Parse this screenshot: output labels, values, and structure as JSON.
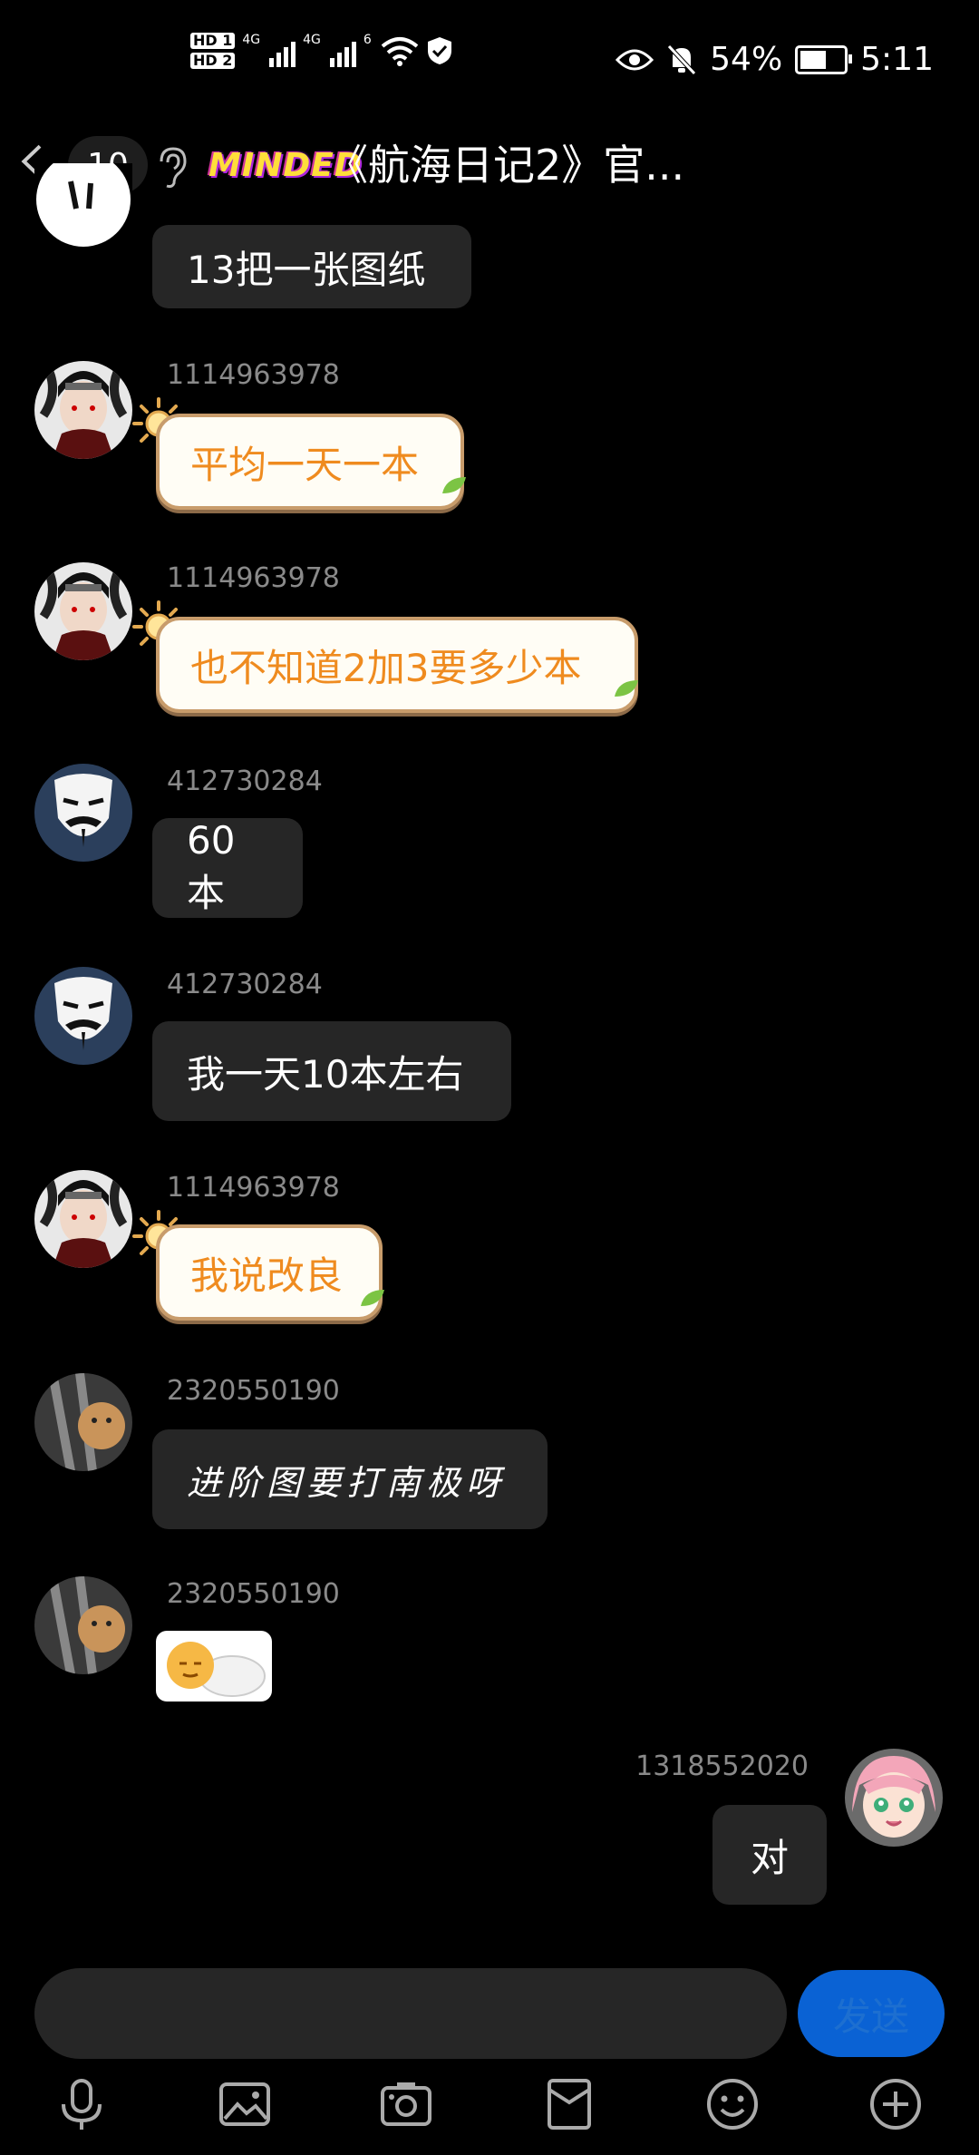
{
  "status_bar": {
    "hd1": "HD 1",
    "hd2": "HD 2",
    "net1": "4G",
    "net2": "4G",
    "wifi": "6",
    "battery": "54%",
    "time": "5:11"
  },
  "header": {
    "unread_count": "10",
    "brand": "MINDED",
    "title": "《航海日记2》官..."
  },
  "messages": [
    {
      "user": "",
      "text": "13把一张图纸",
      "style": "normal"
    },
    {
      "user": "1114963978",
      "text": "平均一天一本",
      "style": "vip"
    },
    {
      "user": "1114963978",
      "text": "也不知道2加3要多少本",
      "style": "vip"
    },
    {
      "user": "412730284",
      "text": "60本",
      "style": "normal"
    },
    {
      "user": "412730284",
      "text": "我一天10本左右",
      "style": "normal"
    },
    {
      "user": "1114963978",
      "text": "我说改良",
      "style": "vip"
    },
    {
      "user": "2320550190",
      "text": "进阶图要打南极呀",
      "style": "handwriting"
    },
    {
      "user": "2320550190",
      "text": "",
      "style": "sticker"
    },
    {
      "user": "1318552020",
      "text": "对",
      "style": "self"
    }
  ],
  "input": {
    "placeholder": "",
    "send_label": "发送"
  },
  "toolbar": [
    "microphone-icon",
    "image-icon",
    "camera-icon",
    "red-packet-icon",
    "emoji-icon",
    "plus-icon"
  ],
  "colors": {
    "background": "#000000",
    "bubble": "#262626",
    "vip_text": "#ef8b1f",
    "send_button": "#0a62d4",
    "username": "#8a8a8a"
  }
}
